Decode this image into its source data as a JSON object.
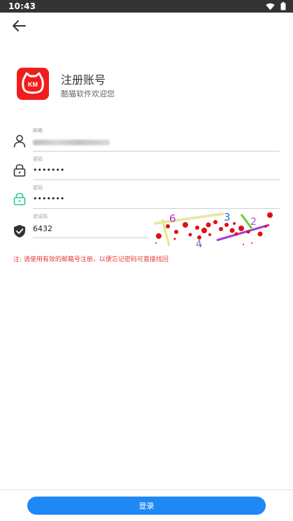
{
  "status_bar": {
    "time": "10:43"
  },
  "header": {
    "title": "注册账号",
    "subtitle": "酷猫软件欢迎您",
    "logo_text": "KM"
  },
  "form": {
    "email": {
      "label": "邮箱"
    },
    "password": {
      "label": "密码",
      "value": "•••••••"
    },
    "confirm_password": {
      "label": "密码",
      "value": "•••••••"
    },
    "captcha": {
      "label": "验证码",
      "value": "6432",
      "image_chars": [
        "6",
        "3",
        "2",
        "4"
      ]
    }
  },
  "note": "注: 请使用有效的邮箱号注册，以便忘记密码可直接找回",
  "login_button": "登录",
  "colors": {
    "accent": "#1e88f5",
    "logo_bg": "#f11d1d",
    "note": "#e53935",
    "confirm_icon": "#29c79b"
  },
  "icons": [
    "back-arrow-icon",
    "person-icon",
    "lock-icon",
    "lock-green-icon",
    "shield-check-icon",
    "wifi-icon",
    "battery-icon"
  ]
}
